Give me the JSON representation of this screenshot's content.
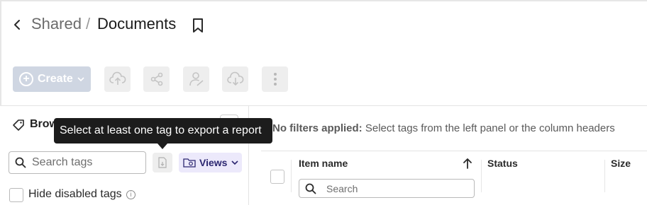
{
  "breadcrumb": {
    "parent": "Shared",
    "separator": "/",
    "current": "Documents"
  },
  "toolbar": {
    "create_label": "Create",
    "buttons": [
      {
        "icon": "cloud-upload-icon"
      },
      {
        "icon": "share-icon"
      },
      {
        "icon": "user-sign-icon"
      },
      {
        "icon": "cloud-download-icon"
      },
      {
        "icon": "more-vertical-icon"
      }
    ]
  },
  "left_panel": {
    "title": "Brow",
    "search_placeholder": "Search tags",
    "views_label": "Views",
    "hide_disabled_label": "Hide disabled tags",
    "tooltip": "Select at least one tag to export a report"
  },
  "filters": {
    "bold": "No filters applied:",
    "text": "Select tags from the left panel or the column headers"
  },
  "table": {
    "columns": [
      "Item name",
      "Status",
      "Size"
    ],
    "search_placeholder": "Search"
  },
  "colors": {
    "create_button_bg": "#cfd6e2",
    "views_button_bg": "#ece9fb",
    "views_button_text": "#2b2670",
    "tooltip_bg": "#1c1c1c"
  }
}
